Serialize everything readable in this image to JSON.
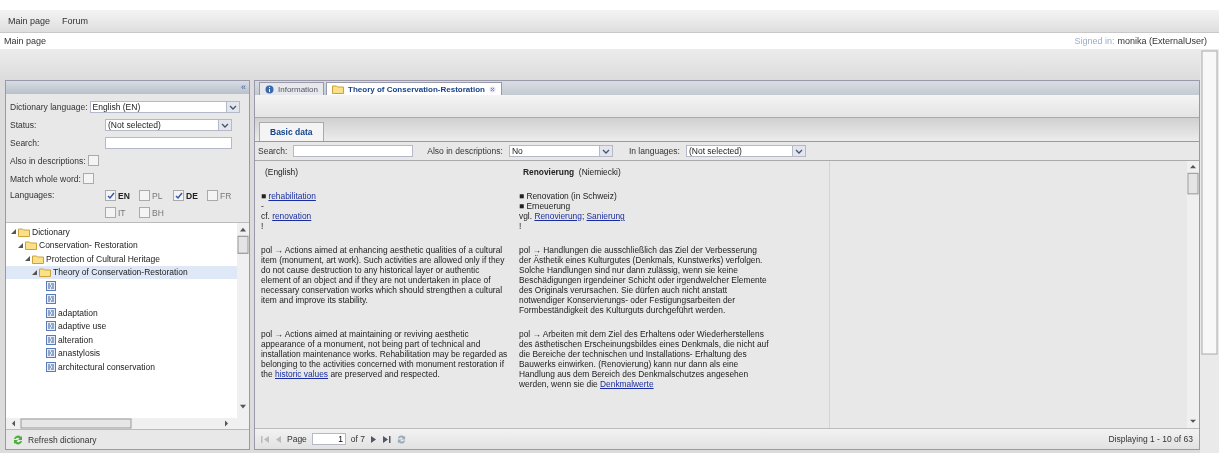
{
  "top_nav": {
    "items": [
      "Main page",
      "Forum"
    ]
  },
  "header": {
    "breadcrumb": "Main page",
    "signed_in_label": "Signed in:",
    "user": "monika (ExternalUser)"
  },
  "left_panel": {
    "collapse": "«",
    "form": {
      "dictionary_language": {
        "label": "Dictionary language:",
        "value": "English (EN)"
      },
      "status": {
        "label": "Status:",
        "value": "(Not selected)"
      },
      "search": {
        "label": "Search:"
      },
      "also_in_descriptions": {
        "label": "Also in descriptions:",
        "checked": false
      },
      "match_whole_word": {
        "label": "Match whole word:",
        "checked": false
      },
      "languages": {
        "label": "Languages:",
        "options": [
          {
            "code": "EN",
            "checked": true
          },
          {
            "code": "PL",
            "checked": false
          },
          {
            "code": "DE",
            "checked": true
          },
          {
            "code": "FR",
            "checked": false
          },
          {
            "code": "IT",
            "checked": false
          },
          {
            "code": "BH",
            "checked": false
          }
        ]
      }
    },
    "tree": [
      {
        "label": "Dictionary",
        "kind": "folder",
        "expanded": true,
        "selected": false,
        "children": [
          {
            "label": "Conservation- Restoration",
            "kind": "folder",
            "expanded": true,
            "selected": false,
            "children": [
              {
                "label": "Protection of Cultural Heritage",
                "kind": "folder",
                "expanded": true,
                "selected": false,
                "children": [
                  {
                    "label": "Theory of Conservation-Restoration",
                    "kind": "folder",
                    "expanded": true,
                    "selected": true,
                    "children": [
                      {
                        "kind": "term",
                        "selected": false
                      },
                      {
                        "kind": "term",
                        "selected": false
                      },
                      {
                        "label": "adaptation",
                        "kind": "term",
                        "selected": false
                      },
                      {
                        "label": "adaptive use",
                        "kind": "term",
                        "selected": false
                      },
                      {
                        "label": "alteration",
                        "kind": "term",
                        "selected": false
                      },
                      {
                        "label": "anastylosis",
                        "kind": "term",
                        "selected": false
                      },
                      {
                        "label": "architectural conservation",
                        "kind": "term",
                        "selected": false
                      }
                    ]
                  }
                ]
              }
            ]
          }
        ]
      }
    ],
    "footer": {
      "button": "Refresh dictionary"
    }
  },
  "main_panel": {
    "tabs": [
      {
        "label": "Information",
        "kind": "info",
        "selected": false,
        "closable": false
      },
      {
        "label": "Theory of Conservation-Restoration",
        "kind": "folder",
        "selected": true,
        "closable": true
      }
    ],
    "sub_tabs": [
      {
        "label": "Basic data",
        "selected": true
      }
    ],
    "filter": {
      "search_label": "Search:",
      "also_label": "Also in descriptions:",
      "also_value": "No",
      "languages_label": "In languages:",
      "languages_value": "(Not selected)"
    },
    "entries": [
      {
        "en": {
          "language": "(English)"
        },
        "de": {
          "term": "Renovierung",
          "language": "(Niemiecki)"
        }
      },
      {
        "en": {
          "lines": [
            [
              {
                "text": "■ "
              },
              {
                "text": "rehabilitation",
                "link": true
              }
            ],
            [
              {
                "text": "-"
              }
            ],
            [
              {
                "text": "cf. "
              },
              {
                "text": "renovation",
                "link": true
              }
            ],
            [
              {
                "text": "!"
              }
            ]
          ]
        },
        "de": {
          "lines": [
            [
              {
                "text": "■ Renovation (in Schweiz)"
              }
            ],
            [
              {
                "text": "■ Erneuerung"
              }
            ],
            [
              {
                "text": "vgl. "
              },
              {
                "text": "Renovierung",
                "link": true
              },
              {
                "text": "; "
              },
              {
                "text": "Sanierung",
                "link": true
              }
            ],
            [
              {
                "text": "!"
              }
            ]
          ]
        }
      },
      {
        "en": {
          "lines": [
            [
              {
                "text": "pol → Actions aimed at enhancing aesthetic qualities of a cultural item (monument, art work). Such activities are allowed only if they do not cause destruction to any historical layer or authentic element of an object and if they are not undertaken in place of necessary conservation works which should strengthen a cultural item and improve its stability."
              }
            ]
          ]
        },
        "de": {
          "lines": [
            [
              {
                "text": "pol → Handlungen die ausschließlich das Ziel der Verbesserung der Ästhetik eines Kulturgutes (Denkmals, Kunstwerks) verfolgen. Solche Handlungen sind nur dann zulässig, wenn sie keine Beschädigungen irgendeiner Schicht oder irgendwelcher Elemente des Originals verursachen. Sie dürfen auch nicht anstatt notwendiger Konservierungs- oder Festigungsarbeiten der Formbeständigkeit des Kulturguts durchgeführt werden."
              }
            ]
          ]
        }
      },
      {
        "en": {
          "lines": [
            [
              {
                "text": "pol → Actions aimed at maintaining or reviving aesthetic appearance of a monument, not being part of technical and installation maintenance works. Rehabilitation may be regarded as belonging to the activities concerned with monument restoration if the "
              },
              {
                "text": "historic values",
                "link": true
              },
              {
                "text": " are preserved and respected."
              }
            ]
          ]
        },
        "de": {
          "lines": [
            [
              {
                "text": "pol → Arbeiten mit dem Ziel des Erhaltens oder Wiederherstellens des ästhetischen Erscheinungsbildes eines Denkmals, die nicht auf die Bereiche der technischen und Installations- Erhaltung des Bauwerks einwirken. (Renovierung) kann nur dann als eine Handlung aus dem Bereich des Denkmalschutzes angesehen werden, wenn sie die "
              },
              {
                "text": "Denkmalwerte",
                "link": true
              }
            ]
          ]
        }
      }
    ],
    "pager": {
      "page_label": "Page",
      "page": "1",
      "of": "of 7",
      "displaying": "Displaying 1 - 10 of 63"
    }
  }
}
